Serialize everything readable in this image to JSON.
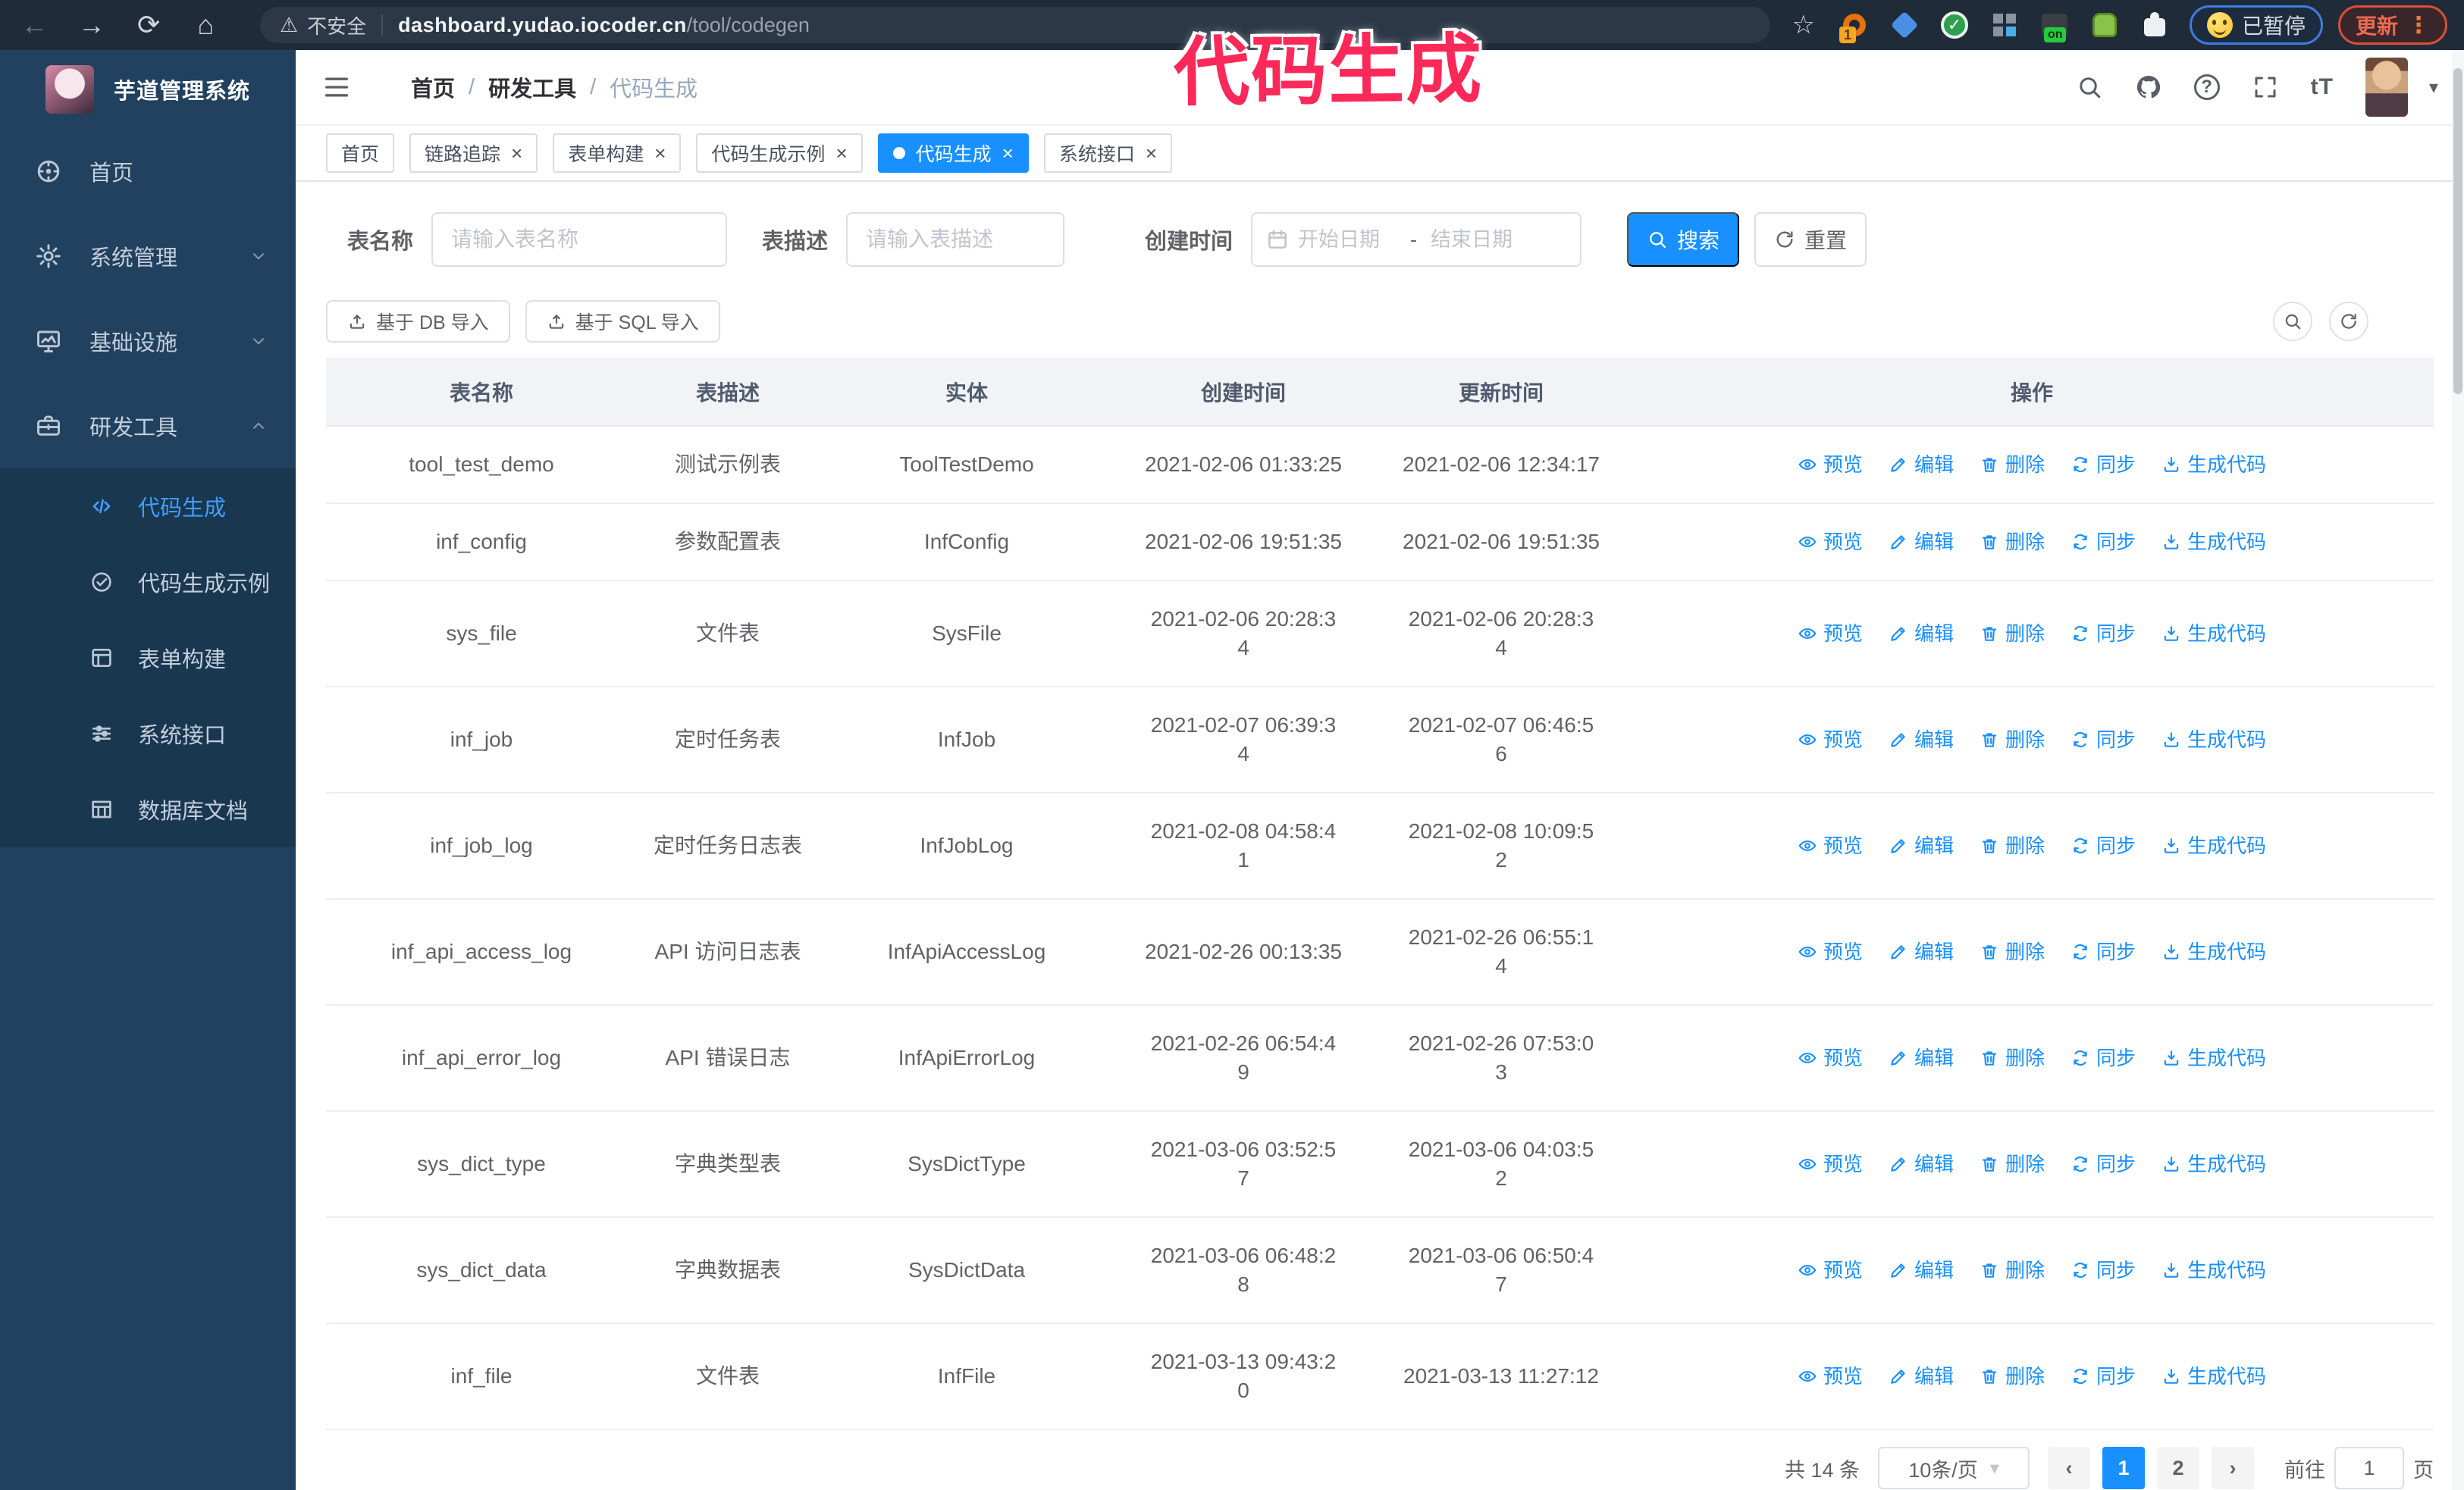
{
  "browser": {
    "back_icon": "←",
    "forward_icon": "→",
    "reload_icon": "⟳",
    "home_icon": "⌂",
    "warning_icon": "⚠",
    "security_label": "不安全",
    "url_host": "dashboard.yudao.iocoder.cn",
    "url_path": "/tool/codegen",
    "star_icon": "☆",
    "ext_badge_1": "1",
    "ext_on_label": "on",
    "paused_badge": "已暂停",
    "update_label": "更新",
    "kebab_icon": "⋮"
  },
  "annotation": {
    "text": "代码生成",
    "color": "#fa2959"
  },
  "icons": {
    "close": "×",
    "caret_down": "▾",
    "prev": "‹",
    "next": "›",
    "check": "✓"
  },
  "colors": {
    "accent": "#1890ff",
    "sidebar": "#21415e",
    "submenu": "#1a3750",
    "active_link": "#409eff"
  },
  "sidebar": {
    "logo_title": "芋道管理系统",
    "items": [
      {
        "label": "首页",
        "icon": "dashboard-icon"
      },
      {
        "label": "系统管理",
        "icon": "gear-icon",
        "chevron": "chevron-down-icon"
      },
      {
        "label": "基础设施",
        "icon": "monitor-icon",
        "chevron": "chevron-down-icon"
      },
      {
        "label": "研发工具",
        "icon": "toolbox-icon",
        "chevron": "chevron-up-icon",
        "expanded": true
      }
    ],
    "subitems": [
      {
        "label": "代码生成",
        "icon": "code-icon",
        "active": true
      },
      {
        "label": "代码生成示例",
        "icon": "example-icon"
      },
      {
        "label": "表单构建",
        "icon": "form-icon"
      },
      {
        "label": "系统接口",
        "icon": "sliders-icon"
      },
      {
        "label": "数据库文档",
        "icon": "dbtable-icon"
      }
    ]
  },
  "header": {
    "breadcrumb": [
      {
        "label": "首页"
      },
      {
        "sep": "/",
        "label": "研发工具"
      },
      {
        "sep": "/",
        "label": "代码生成",
        "current": true
      }
    ]
  },
  "tabs": [
    {
      "label": "首页"
    },
    {
      "label": "链路追踪",
      "closable": true
    },
    {
      "label": "表单构建",
      "closable": true
    },
    {
      "label": "代码生成示例",
      "closable": true
    },
    {
      "label": "代码生成",
      "closable": true,
      "active": true
    },
    {
      "label": "系统接口",
      "closable": true
    }
  ],
  "filters": {
    "table_name_label": "表名称",
    "table_name_placeholder": "请输入表名称",
    "table_desc_label": "表描述",
    "table_desc_placeholder": "请输入表描述",
    "create_time_label": "创建时间",
    "start_placeholder": "开始日期",
    "range_separator": "-",
    "end_placeholder": "结束日期",
    "search_label": "搜索",
    "reset_label": "重置"
  },
  "toolbar": {
    "import_db": "基于 DB 导入",
    "import_sql": "基于 SQL 导入"
  },
  "table": {
    "columns": [
      "表名称",
      "表描述",
      "实体",
      "创建时间",
      "更新时间",
      "操作"
    ],
    "action_labels": [
      "预览",
      "编辑",
      "删除",
      "同步",
      "生成代码"
    ],
    "action_icons": [
      "eye-icon",
      "edit-icon",
      "delete-icon",
      "sync-icon",
      "download-icon"
    ],
    "action_names": [
      "preview",
      "edit",
      "delete",
      "sync",
      "generate-code"
    ],
    "rows": [
      {
        "name": "tool_test_demo",
        "desc": "测试示例表",
        "entity": "ToolTestDemo",
        "created": "2021-02-06 01:33:25",
        "updated": "2021-02-06 12:34:17"
      },
      {
        "name": "inf_config",
        "desc": "参数配置表",
        "entity": "InfConfig",
        "created": "2021-02-06 19:51:35",
        "updated": "2021-02-06 19:51:35"
      },
      {
        "name": "sys_file",
        "desc": "文件表",
        "entity": "SysFile",
        "created": "2021-02-06 20:28:3\n4",
        "updated": "2021-02-06 20:28:3\n4"
      },
      {
        "name": "inf_job",
        "desc": "定时任务表",
        "entity": "InfJob",
        "created": "2021-02-07 06:39:3\n4",
        "updated": "2021-02-07 06:46:5\n6"
      },
      {
        "name": "inf_job_log",
        "desc": "定时任务日志表",
        "entity": "InfJobLog",
        "created": "2021-02-08 04:58:4\n1",
        "updated": "2021-02-08 10:09:5\n2"
      },
      {
        "name": "inf_api_access_log",
        "desc": "API 访问日志表",
        "entity": "InfApiAccessLog",
        "created": "2021-02-26 00:13:35",
        "updated": "2021-02-26 06:55:1\n4"
      },
      {
        "name": "inf_api_error_log",
        "desc": "API 错误日志",
        "entity": "InfApiErrorLog",
        "created": "2021-02-26 06:54:4\n9",
        "updated": "2021-02-26 07:53:0\n3"
      },
      {
        "name": "sys_dict_type",
        "desc": "字典类型表",
        "entity": "SysDictType",
        "created": "2021-03-06 03:52:5\n7",
        "updated": "2021-03-06 04:03:5\n2"
      },
      {
        "name": "sys_dict_data",
        "desc": "字典数据表",
        "entity": "SysDictData",
        "created": "2021-03-06 06:48:2\n8",
        "updated": "2021-03-06 06:50:4\n7"
      },
      {
        "name": "inf_file",
        "desc": "文件表",
        "entity": "InfFile",
        "created": "2021-03-13 09:43:2\n0",
        "updated": "2021-03-13 11:27:12"
      }
    ]
  },
  "pagination": {
    "total": "共 14 条",
    "page_size": "10条/页",
    "pages": [
      {
        "label": "1",
        "active": true
      },
      {
        "label": "2"
      }
    ],
    "goto_label": "前往",
    "goto_value": "1",
    "goto_suffix": "页"
  }
}
